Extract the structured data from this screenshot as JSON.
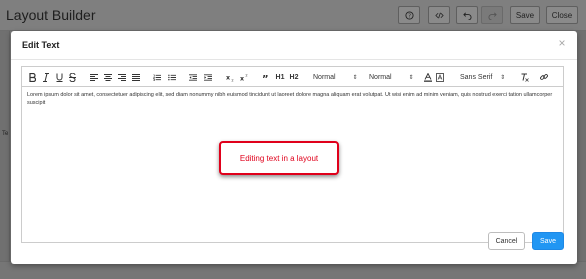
{
  "app": {
    "title": "Layout Builder",
    "header_buttons": {
      "save_label": "Save",
      "close_label": "Close"
    },
    "side_label": "Te"
  },
  "modal": {
    "title": "Edit Text",
    "toolbar": {
      "header1": "H1",
      "header2": "H2",
      "size_select": "Normal",
      "header_select": "Normal",
      "font_select": "Sans Serif"
    },
    "content": "Lorem ipsum dolor sit amet, consectetuer adipiscing elit, sed diam nonummy nibh euismod tincidunt ut laoreet dolore magna aliquam erat volutpat. Ut wisi enim ad minim veniam, quis nostrud exerci tation ullamcorper suscipit",
    "callout": "Editing text in a layout",
    "cancel_label": "Cancel",
    "save_label": "Save"
  },
  "colors": {
    "accent": "#2196f3",
    "callout": "#e0001b"
  }
}
